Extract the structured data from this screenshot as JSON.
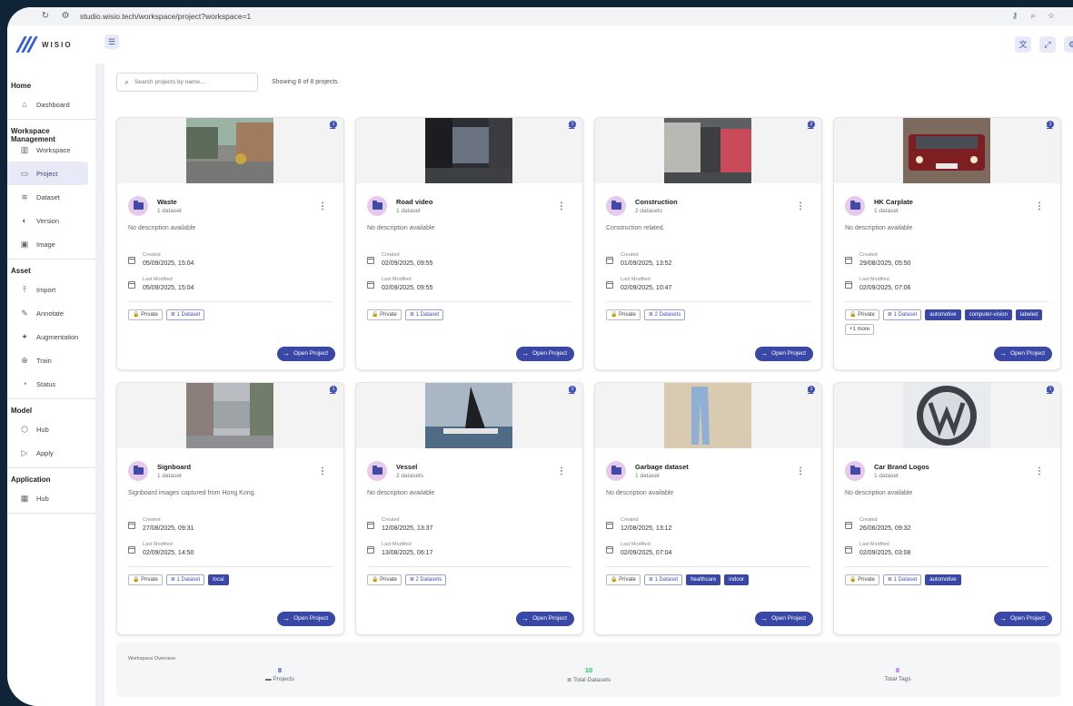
{
  "browser": {
    "url": "studio.wisio.tech/workspace/project?workspace=1"
  },
  "app": {
    "logo_text": "WISIO"
  },
  "sidebar": {
    "sections": [
      {
        "title": "Home",
        "items": [
          {
            "label": "Dashboard",
            "icon": "home-icon"
          }
        ]
      },
      {
        "title": "Workspace Management",
        "items": [
          {
            "label": "Workspace",
            "icon": "building-icon"
          },
          {
            "label": "Project",
            "icon": "folder-icon",
            "active": true
          },
          {
            "label": "Dataset",
            "icon": "database-icon"
          },
          {
            "label": "Version",
            "icon": "version-icon"
          },
          {
            "label": "Image",
            "icon": "image-icon"
          }
        ]
      },
      {
        "title": "Asset",
        "items": [
          {
            "label": "Import",
            "icon": "upload-icon"
          },
          {
            "label": "Annotate",
            "icon": "edit-icon"
          },
          {
            "label": "Augmentation",
            "icon": "magic-icon"
          },
          {
            "label": "Train",
            "icon": "train-icon"
          },
          {
            "label": "Status",
            "icon": "status-icon"
          }
        ]
      },
      {
        "title": "Model",
        "items": [
          {
            "label": "Hub",
            "icon": "cube-icon"
          },
          {
            "label": "Apply",
            "icon": "play-icon"
          }
        ]
      },
      {
        "title": "Application",
        "items": [
          {
            "label": "Hub",
            "icon": "grid-icon"
          }
        ]
      }
    ]
  },
  "toolbar": {
    "search_placeholder": "Search projects by name...",
    "showing_text": "Showing 8 of 8 projects"
  },
  "card_labels": {
    "created": "Created",
    "modified": "Last Modified",
    "open": "Open Project"
  },
  "projects": [
    {
      "name": "Waste",
      "datasets_text": "1 dataset",
      "badge": "1",
      "desc": "No description available",
      "created": "05/09/2025, 15:04",
      "modified": "05/09/2025, 15:04",
      "chips": [
        {
          "t": "Private",
          "k": "priv"
        },
        {
          "t": "1 Dataset",
          "k": "ds"
        }
      ]
    },
    {
      "name": "Road video",
      "datasets_text": "1 dataset",
      "badge": "1",
      "desc": "No description available",
      "created": "02/09/2025, 09:55",
      "modified": "02/09/2025, 09:55",
      "chips": [
        {
          "t": "Private",
          "k": "priv"
        },
        {
          "t": "1 Dataset",
          "k": "ds"
        }
      ]
    },
    {
      "name": "Construction",
      "datasets_text": "2 datasets",
      "badge": "2",
      "desc": "Construction related.",
      "created": "01/09/2025, 13:52",
      "modified": "02/09/2025, 10:47",
      "chips": [
        {
          "t": "Private",
          "k": "priv"
        },
        {
          "t": "2 Datasets",
          "k": "ds"
        }
      ]
    },
    {
      "name": "HK Carplate",
      "datasets_text": "1 dataset",
      "badge": "1",
      "desc": "No description available",
      "created": "29/08/2025, 05:50",
      "modified": "02/09/2025, 07:06",
      "chips": [
        {
          "t": "Private",
          "k": "priv"
        },
        {
          "t": "1 Dataset",
          "k": "ds"
        },
        {
          "t": "automotive",
          "k": "tag"
        },
        {
          "t": "computer-vision",
          "k": "tag"
        },
        {
          "t": "labeled",
          "k": "tag"
        },
        {
          "t": "+1 more",
          "k": "more"
        }
      ]
    },
    {
      "name": "Signboard",
      "datasets_text": "1 dataset",
      "badge": "1",
      "desc": "Signboard images captured from Hong Kong.",
      "created": "27/08/2025, 09:31",
      "modified": "02/09/2025, 14:50",
      "chips": [
        {
          "t": "Private",
          "k": "priv"
        },
        {
          "t": "1 Dataset",
          "k": "ds"
        },
        {
          "t": "local",
          "k": "tag"
        }
      ]
    },
    {
      "name": "Vessel",
      "datasets_text": "2 datasets",
      "badge": "2",
      "desc": "No description available",
      "created": "12/08/2025, 13:37",
      "modified": "13/08/2025, 06:17",
      "chips": [
        {
          "t": "Private",
          "k": "priv"
        },
        {
          "t": "2 Datasets",
          "k": "ds"
        }
      ]
    },
    {
      "name": "Garbage dataset",
      "datasets_text": "1 dataset",
      "badge": "1",
      "desc": "No description available",
      "created": "12/08/2025, 13:12",
      "modified": "02/09/2025, 07:04",
      "chips": [
        {
          "t": "Private",
          "k": "priv"
        },
        {
          "t": "1 Dataset",
          "k": "ds"
        },
        {
          "t": "healthcare",
          "k": "tag"
        },
        {
          "t": "indoor",
          "k": "tag"
        }
      ]
    },
    {
      "name": "Car Brand Logos",
      "datasets_text": "1 dataset",
      "badge": "1",
      "desc": "No description available",
      "created": "26/06/2025, 09:32",
      "modified": "02/09/2025, 03:08",
      "chips": [
        {
          "t": "Private",
          "k": "priv"
        },
        {
          "t": "1 Dataset",
          "k": "ds"
        },
        {
          "t": "automotive",
          "k": "tag"
        }
      ]
    }
  ],
  "overview": {
    "title": "Workspace Overview",
    "items": [
      {
        "value": "8",
        "label": "Projects",
        "color": "#3f51b5",
        "icon": "folder-icon"
      },
      {
        "value": "10",
        "label": "Total Datasets",
        "color": "#22c55e",
        "icon": "list-icon"
      },
      {
        "value": "8",
        "label": "Total Tags",
        "color": "#a855f7",
        "icon": ""
      }
    ]
  },
  "colors": {
    "accent": "#3947a6",
    "folder_bg": "#e7c9ee"
  }
}
